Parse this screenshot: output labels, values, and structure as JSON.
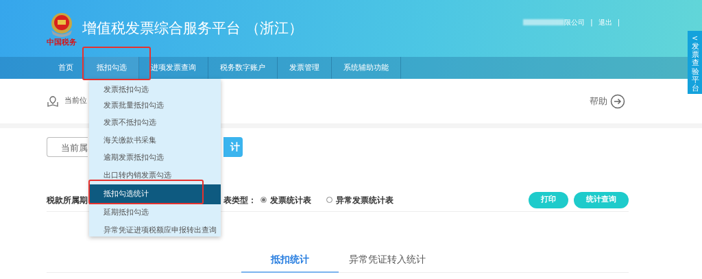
{
  "header": {
    "logo_text": "中国税务",
    "title": "增值税发票综合服务平台 （浙江）"
  },
  "user_bar": {
    "company": "限公司",
    "logout": "退出",
    "separator": "|"
  },
  "nav": [
    {
      "label": "首页",
      "open": false
    },
    {
      "label": "抵扣勾选",
      "open": true
    },
    {
      "label": "进项发票查询",
      "open": false
    },
    {
      "label": "税务数字账户",
      "open": false
    },
    {
      "label": "发票管理",
      "open": false
    },
    {
      "label": "系统辅助功能",
      "open": false
    }
  ],
  "side_tab": {
    "arrow": "<",
    "label": "发票查验平台"
  },
  "breadcrumb": {
    "text": "当前位"
  },
  "help": {
    "label": "帮助"
  },
  "period_field": {
    "value": "当前属"
  },
  "period_button": {
    "label": "计"
  },
  "filters": {
    "period_label": "税款所属期",
    "type_label": "表类型：",
    "options": [
      {
        "label": "发票统计表",
        "selected": true
      },
      {
        "label": "异常发票统计表",
        "selected": false
      }
    ]
  },
  "actions": [
    "打印",
    "统计查询"
  ],
  "tabs": [
    {
      "label": "抵扣统计",
      "selected": true
    },
    {
      "label": "异常凭证转入统计",
      "selected": false
    }
  ],
  "dropdown": [
    {
      "label": "发票抵扣勾选",
      "selected": false
    },
    {
      "label": "发票批量抵扣勾选",
      "selected": false
    },
    {
      "label": "发票不抵扣勾选",
      "selected": false
    },
    {
      "label": "海关缴款书采集",
      "selected": false
    },
    {
      "label": "逾期发票抵扣勾选",
      "selected": false
    },
    {
      "label": "出口转内销发票勾选",
      "selected": false
    },
    {
      "label": "抵扣勾选统计",
      "selected": true
    },
    {
      "label": "延期抵扣勾选",
      "selected": false
    },
    {
      "label": "异常凭证进项税额应申报转出查询",
      "selected": false
    }
  ]
}
